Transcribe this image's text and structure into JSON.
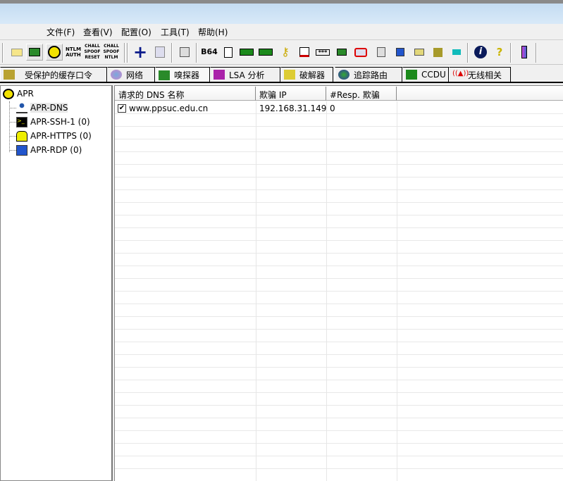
{
  "menu": [
    "文件(F)",
    "查看(V)",
    "配置(O)",
    "工具(T)",
    "帮助(H)"
  ],
  "toolbar": {
    "ntlm_auth": "NTLM AUTH",
    "chall_spoof_reset": "CHALL SPOOF RESET",
    "chall_spoof_ntlm": "CHALL SPOOF NTLM",
    "base64": "B64",
    "info": "i",
    "help": "?"
  },
  "tabs": [
    "受保护的缓存口令",
    "网络",
    "嗅探器",
    "LSA 分析",
    "破解器",
    "追踪路由",
    "CCDU",
    "无线相关"
  ],
  "tree": {
    "root": "APR",
    "children": [
      "APR-DNS",
      "APR-SSH-1 (0)",
      "APR-HTTPS (0)",
      "APR-RDP (0)"
    ]
  },
  "table": {
    "headers": [
      "请求的 DNS 名称",
      "欺骗 IP",
      "#Resp. 欺骗"
    ],
    "rows": [
      {
        "checked": true,
        "check_mark": "✔",
        "name": "www.ppsuc.edu.cn",
        "ip": "192.168.31.149",
        "resp": "0"
      }
    ]
  }
}
